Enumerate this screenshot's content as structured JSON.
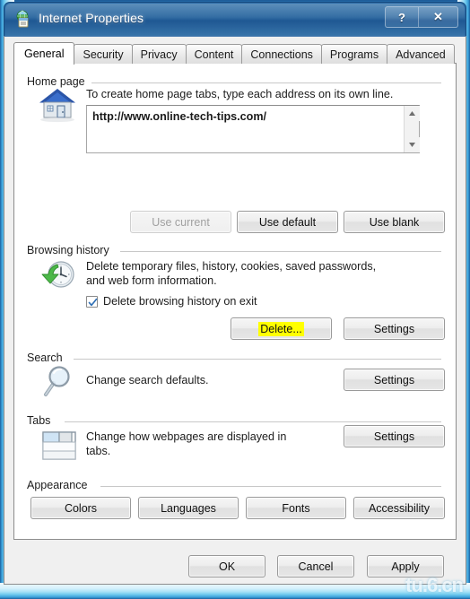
{
  "window": {
    "title": "Internet Properties",
    "icon": "internet-properties-icon",
    "help_label": "?",
    "close_label": "✕"
  },
  "tabs": [
    {
      "label": "General",
      "active": true
    },
    {
      "label": "Security",
      "active": false
    },
    {
      "label": "Privacy",
      "active": false
    },
    {
      "label": "Content",
      "active": false
    },
    {
      "label": "Connections",
      "active": false
    },
    {
      "label": "Programs",
      "active": false
    },
    {
      "label": "Advanced",
      "active": false
    }
  ],
  "home_page": {
    "group_label": "Home page",
    "icon": "house-icon",
    "description": "To create home page tabs, type each address on its own line.",
    "url_value": "http://www.online-tech-tips.com/",
    "scroll_up_icon": "scroll-up-arrow-icon",
    "scroll_down_icon": "scroll-down-arrow-icon",
    "buttons": {
      "use_current": "Use current",
      "use_default": "Use default",
      "use_blank": "Use blank"
    }
  },
  "browsing_history": {
    "group_label": "Browsing history",
    "icon": "clock-refresh-icon",
    "description_line1": "Delete temporary files, history, cookies, saved passwords,",
    "description_line2": "and web form information.",
    "checkbox_label": "Delete browsing history on exit",
    "checkbox_checked": true,
    "buttons": {
      "delete": "Delete...",
      "settings": "Settings"
    },
    "highlight_color": "#ffff00"
  },
  "search": {
    "group_label": "Search",
    "icon": "magnifier-icon",
    "description": "Change search defaults.",
    "buttons": {
      "settings": "Settings"
    }
  },
  "tabs_section": {
    "group_label": "Tabs",
    "icon": "browser-tabs-icon",
    "description_line1": "Change how webpages are displayed in",
    "description_line2": "tabs.",
    "buttons": {
      "settings": "Settings"
    }
  },
  "appearance": {
    "group_label": "Appearance",
    "buttons": {
      "colors": "Colors",
      "languages": "Languages",
      "fonts": "Fonts",
      "accessibility": "Accessibility"
    }
  },
  "footer": {
    "ok": "OK",
    "cancel": "Cancel",
    "apply": "Apply"
  },
  "watermark": {
    "text": "tu.6.cn"
  },
  "colors": {
    "titlebar": "#24629c",
    "frame_glass": "#9fe0f5",
    "dialog_bg": "#f0f0f0",
    "page_bg": "#ffffff",
    "highlight": "#ffff00",
    "checkbox_check": "#2f6fb5"
  }
}
